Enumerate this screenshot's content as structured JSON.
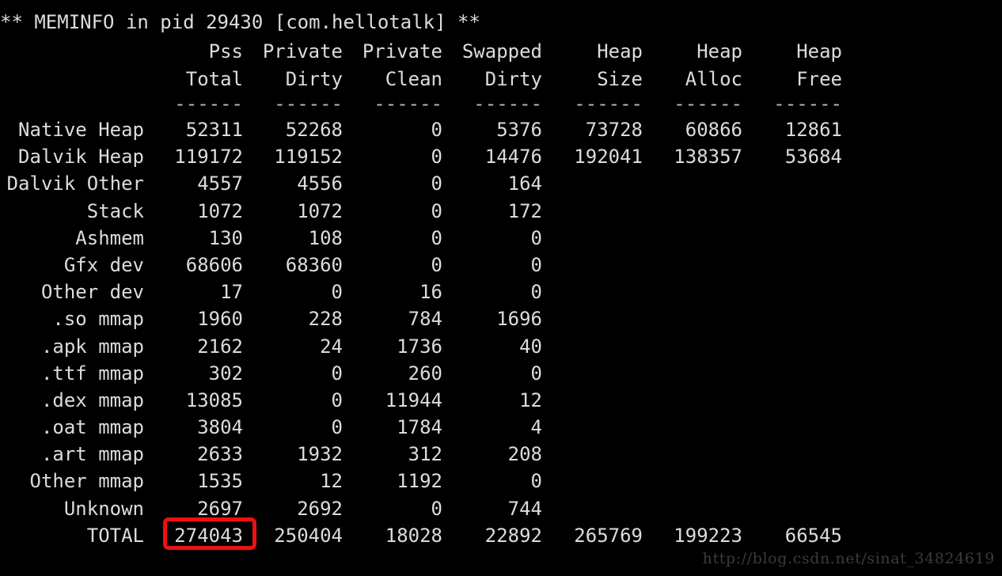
{
  "terminal": {
    "background_color": "#000000",
    "text_color": "#dcdcdc",
    "title": "** MEMINFO in pid 29430 [com.hellotalk] **",
    "header_row_1": [
      "",
      "Pss",
      "Private",
      "Private",
      "Swapped",
      "Heap",
      "Heap",
      "Heap"
    ],
    "header_row_2": [
      "",
      "Total",
      "Dirty",
      "Clean",
      "Dirty",
      "Size",
      "Alloc",
      "Free"
    ],
    "separator": "------",
    "separator_count": 7,
    "columns": [
      "",
      "Pss Total",
      "Private Dirty",
      "Private Clean",
      "Swapped Dirty",
      "Heap Size",
      "Heap Alloc",
      "Heap Free"
    ],
    "rows": [
      {
        "label": "Native Heap",
        "values": [
          "52311",
          "52268",
          "0",
          "5376",
          "73728",
          "60866",
          "12861"
        ]
      },
      {
        "label": "Dalvik Heap",
        "values": [
          "119172",
          "119152",
          "0",
          "14476",
          "192041",
          "138357",
          "53684"
        ]
      },
      {
        "label": "Dalvik Other",
        "values": [
          "4557",
          "4556",
          "0",
          "164",
          "",
          "",
          ""
        ]
      },
      {
        "label": "Stack",
        "values": [
          "1072",
          "1072",
          "0",
          "172",
          "",
          "",
          ""
        ]
      },
      {
        "label": "Ashmem",
        "values": [
          "130",
          "108",
          "0",
          "0",
          "",
          "",
          ""
        ]
      },
      {
        "label": "Gfx dev",
        "values": [
          "68606",
          "68360",
          "0",
          "0",
          "",
          "",
          ""
        ]
      },
      {
        "label": "Other dev",
        "values": [
          "17",
          "0",
          "16",
          "0",
          "",
          "",
          ""
        ]
      },
      {
        "label": ".so mmap",
        "values": [
          "1960",
          "228",
          "784",
          "1696",
          "",
          "",
          ""
        ]
      },
      {
        "label": ".apk mmap",
        "values": [
          "2162",
          "24",
          "1736",
          "40",
          "",
          "",
          ""
        ]
      },
      {
        "label": ".ttf mmap",
        "values": [
          "302",
          "0",
          "260",
          "0",
          "",
          "",
          ""
        ]
      },
      {
        "label": ".dex mmap",
        "values": [
          "13085",
          "0",
          "11944",
          "12",
          "",
          "",
          ""
        ]
      },
      {
        "label": ".oat mmap",
        "values": [
          "3804",
          "0",
          "1784",
          "4",
          "",
          "",
          ""
        ]
      },
      {
        "label": ".art mmap",
        "values": [
          "2633",
          "1932",
          "312",
          "208",
          "",
          "",
          ""
        ]
      },
      {
        "label": "Other mmap",
        "values": [
          "1535",
          "12",
          "1192",
          "0",
          "",
          "",
          ""
        ]
      },
      {
        "label": "Unknown",
        "values": [
          "2697",
          "2692",
          "0",
          "744",
          "",
          "",
          ""
        ]
      },
      {
        "label": "TOTAL",
        "values": [
          "274043",
          "250404",
          "18028",
          "22892",
          "265769",
          "199223",
          "66545"
        ]
      }
    ]
  },
  "annotation": {
    "highlight_color": "#ee1111",
    "highlight_target_value": "274043",
    "highlight_target_label": "TOTAL",
    "highlight_target_column": "Pss Total"
  },
  "watermark": {
    "text": "http://blog.csdn.net/sinat_34824619",
    "color": "#3b3b3b"
  }
}
